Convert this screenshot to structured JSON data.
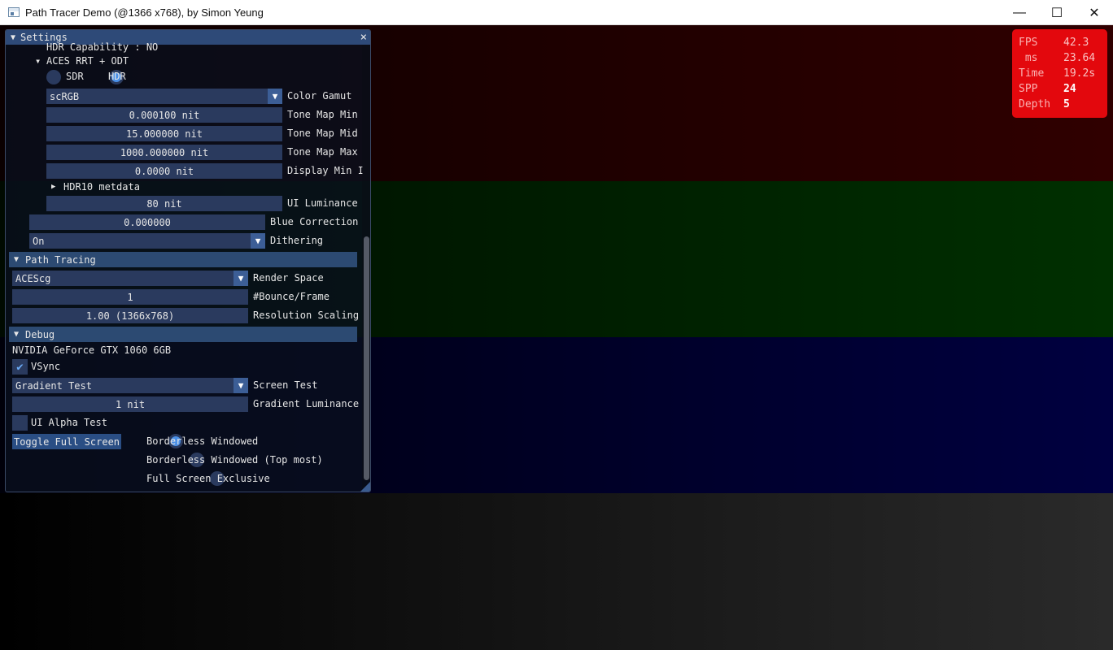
{
  "window": {
    "title": "Path Tracer Demo (@1366 x768), by Simon Yeung",
    "minimize_glyph": "—",
    "maximize_glyph": "☐",
    "close_glyph": "✕"
  },
  "stats": {
    "fps_label": "FPS",
    "fps_value": "42.3",
    "ms_label": " ms",
    "ms_value": "23.64",
    "time_label": "Time",
    "time_value": "19.2s",
    "spp_label": "SPP",
    "spp_value": "24",
    "depth_label": "Depth",
    "depth_value": "5"
  },
  "settings": {
    "title": "Settings",
    "close_glyph": "×",
    "hdr_capability_text": "HDR Capability          : NO",
    "aces_node_label": "ACES RRT + ODT",
    "sdr_label": "SDR",
    "hdr_label": "HDR",
    "color_gamut_value": "scRGB",
    "color_gamut_label": "Color Gamut",
    "tone_map_min_value": "0.000100 nit",
    "tone_map_min_label": "Tone Map Min",
    "tone_map_mid_value": "15.000000 nit",
    "tone_map_mid_label": "Tone Map Mid",
    "tone_map_max_value": "1000.000000 nit",
    "tone_map_max_label": "Tone Map Max",
    "display_min_value": "0.0000 nit",
    "display_min_label": "Display Min I",
    "hdr10_metadata_label": "HDR10 metdata",
    "ui_luminance_value": "80 nit",
    "ui_luminance_label": "UI Luminance",
    "blue_correction_value": "0.000000",
    "blue_correction_label": "Blue Correction",
    "dithering_value": "On",
    "dithering_label": "Dithering",
    "path_tracing_header": "Path Tracing",
    "render_space_value": "ACEScg",
    "render_space_label": "Render Space",
    "bounce_value": "1",
    "bounce_label": "#Bounce/Frame",
    "resolution_value": "1.00 (1366x768)",
    "resolution_label": "Resolution Scaling",
    "debug_header": "Debug",
    "gpu_name": "NVIDIA GeForce GTX 1060 6GB",
    "vsync_label": "VSync",
    "screen_test_value": "Gradient Test",
    "screen_test_label": "Screen Test",
    "gradient_luminance_value": "1 nit",
    "gradient_luminance_label": "Gradient Luminance",
    "ui_alpha_test_label": "UI Alpha Test",
    "toggle_full_screen_label": "Toggle Full Screen",
    "borderless_windowed_label": "Borderless Windowed",
    "borderless_topmost_label": "Borderless Windowed (Top most)",
    "full_screen_exclusive_label": "Full Screen Exclusive"
  }
}
